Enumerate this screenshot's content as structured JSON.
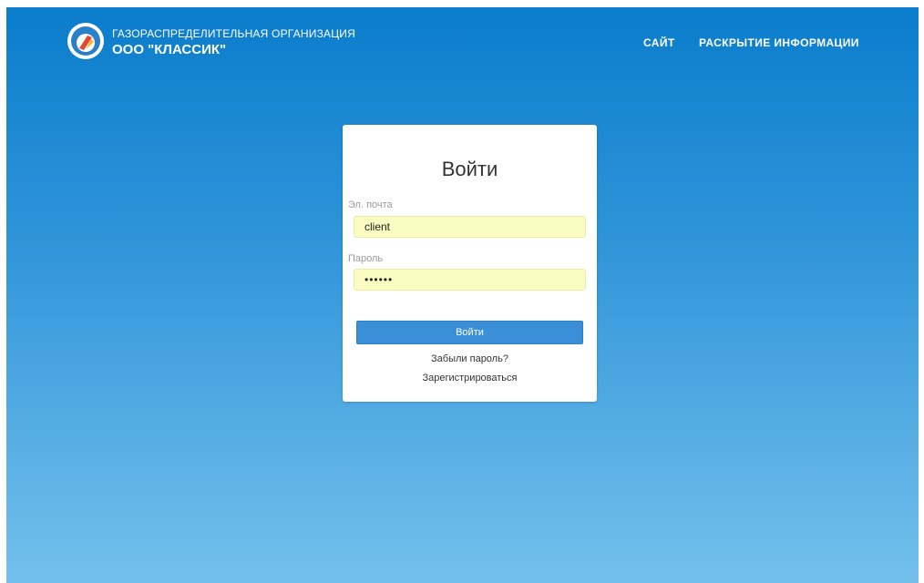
{
  "header": {
    "org_type": "ГАЗОРАСПРЕДЕЛИТЕЛЬНАЯ ОРГАНИЗАЦИЯ",
    "org_name": "ООО \"КЛАССИК\"",
    "logo_text": "КЛАССИК",
    "nav": [
      {
        "label": "САЙТ"
      },
      {
        "label": "РАСКРЫТИЕ ИНФОРМАЦИИ"
      }
    ]
  },
  "login": {
    "title": "Войти",
    "email_label": "Эл. почта",
    "email_value": "client",
    "password_label": "Пароль",
    "password_value": "••••••",
    "submit_label": "Войти",
    "forgot_link": "Забыли пароль?",
    "register_link": "Зарегистрироваться"
  },
  "colors": {
    "background_top": "#0a7dcc",
    "background_bottom": "#73c0ec",
    "button": "#3a8fd8",
    "autofill": "#fafcc2"
  }
}
